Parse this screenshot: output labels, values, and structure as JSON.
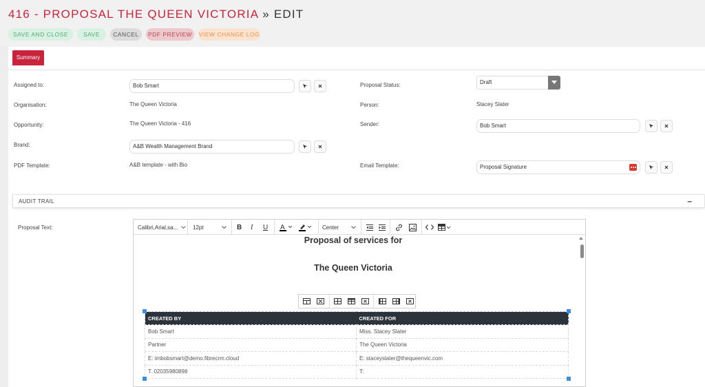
{
  "header": {
    "title_main": "416 - PROPOSAL THE QUEEN VICTORIA",
    "title_rest": " » EDIT",
    "buttons": {
      "save_and_close": "SAVE AND CLOSE",
      "save": "SAVE",
      "cancel": "CANCEL",
      "pdf_preview": "PDF PREVIEW",
      "view_change_log": "VIEW CHANGE LOG"
    }
  },
  "tabs": {
    "summary": "Summary"
  },
  "form": {
    "assigned_to": {
      "label": "Assigned to:",
      "value": "Bob Smart"
    },
    "organisation": {
      "label": "Organisation:",
      "value": "The Queen Victoria"
    },
    "opportunity": {
      "label": "Opportunity:",
      "value": "The Queen Victoria - 416"
    },
    "brand": {
      "label": "Brand:",
      "value": "A&B Wealth Management Brand"
    },
    "pdf_template": {
      "label": "PDF Template:",
      "value": "A&B template - with Bio"
    },
    "proposal_status": {
      "label": "Proposal Status:",
      "value": "Draft"
    },
    "person": {
      "label": "Person:",
      "value": "Stacey Slater"
    },
    "sender": {
      "label": "Sender:",
      "value": "Bob Smart"
    },
    "email_template": {
      "label": "Email Template:",
      "value": "Proposal Signature"
    }
  },
  "audit_trail": {
    "label": "AUDIT TRAIL",
    "toggle": "–"
  },
  "editor": {
    "label": "Proposal Text:",
    "toolbar": {
      "font_family": "Calibri,Arial,sa...",
      "font_size": "12pt",
      "bold": "B",
      "italic": "I",
      "underline": "U",
      "align": "Center"
    },
    "heading_1": "Proposal of services for",
    "heading_2": "The Queen Victoria",
    "table": {
      "headers": [
        "CREATED BY",
        "CREATED FOR"
      ],
      "rows": [
        [
          "Bob Smart",
          "Miss. Stacey Slater"
        ],
        [
          "Partner",
          "The Queen Victoria"
        ],
        [
          "E: imbobsmart@demo.fibrecrm.cloud",
          "E: staceyslater@thequeenvic.com"
        ],
        [
          "T. 02035980898",
          "T:"
        ]
      ]
    }
  },
  "colors": {
    "brand_red": "#c9243c",
    "save_green": "#5aa874",
    "pdf_red": "#b14a57",
    "log_orange": "#e5954f"
  }
}
